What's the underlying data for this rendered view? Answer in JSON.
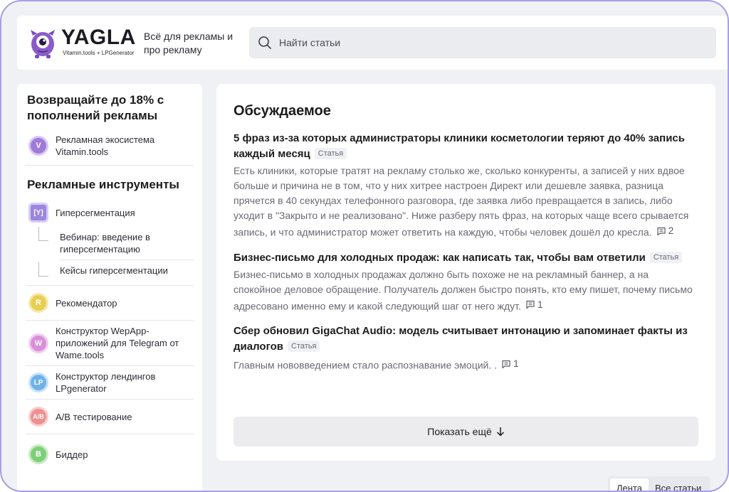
{
  "header": {
    "logo": {
      "word": "YAGLA",
      "sub": "Vitamin.tools + LPGenerator"
    },
    "tagline": "Всё для рекламы и про рекламу",
    "search": {
      "placeholder": "Найти статьи"
    }
  },
  "sidebar": {
    "promo_heading": "Возвращайте до 18% с пополнений рекламы",
    "promo_item": {
      "badge": "V",
      "label": "Рекламная экосистема Vitamin.tools",
      "color": "#a07ad9"
    },
    "tools_heading": "Рекламные инструменты",
    "hyper": {
      "badge": "[Y]",
      "label": "Гиперсегментация",
      "color": "#9b86e0",
      "sub_items": [
        "Вебинар: введение в гиперсегментацию",
        "Кейсы гиперсегментации"
      ]
    },
    "tools": [
      {
        "badge": "R",
        "label": "Рекомендатор",
        "color": "#e8cf52"
      },
      {
        "badge": "W",
        "label": "Конструктор WepApp-приложений для Telegram от Wame.tools",
        "color": "#d98fd9"
      },
      {
        "badge": "LP",
        "label": "Конструктор лендингов LPgenerator",
        "color": "#6fb2e8"
      },
      {
        "badge": "A/B",
        "label": "A/B тестирование",
        "color": "#ef8f8f"
      },
      {
        "badge": "B",
        "label": "Биддер",
        "color": "#7fcf7a"
      }
    ]
  },
  "main": {
    "title": "Обсуждаемое",
    "tag_label": "Статья",
    "articles": [
      {
        "title": "5 фраз из-за которых администраторы клиники косметологии теряют до 40% запись каждый месяц",
        "excerpt": "Есть клиники, которые тратят на рекламу столько же, сколько конкуренты, а записей у них вдвое больше и причина не в том, что у них хитрее настроен Директ или дешевле заявка, разница прячется в 40 секундах телефонного разговора, где заявка либо превращается в запись, либо уходит в \"Закрыто и не реализовано\". Ниже разберу пять фраз, на которых чаще всего срывается запись, и что администратор может ответить на каждую, чтобы человек дошёл до кресла.",
        "comments": "2"
      },
      {
        "title": "Бизнес-письмо для холодных продаж: как написать так, чтобы вам ответили",
        "excerpt": "Бизнес-письмо в холодных продажах должно быть похоже не на рекламный баннер, а на спокойное деловое обращение. Получатель должен быстро понять, кто ему пишет, почему письмо адресовано именно ему и какой следующий шаг от него ждут.",
        "comments": "1"
      },
      {
        "title": "Сбер обновил GigaChat Audio: модель считывает интонацию и запоминает факты из диалогов",
        "excerpt": "Главным нововведением стало распознавание эмоций. .",
        "comments": "1"
      }
    ],
    "more_button": "Показать ещё"
  },
  "feed_tabs": [
    "Лента",
    "Все статьи"
  ],
  "colors": {
    "frame_border": "#a99ee6",
    "background": "#f0f1f4",
    "mascot": "#8a5cc9"
  }
}
